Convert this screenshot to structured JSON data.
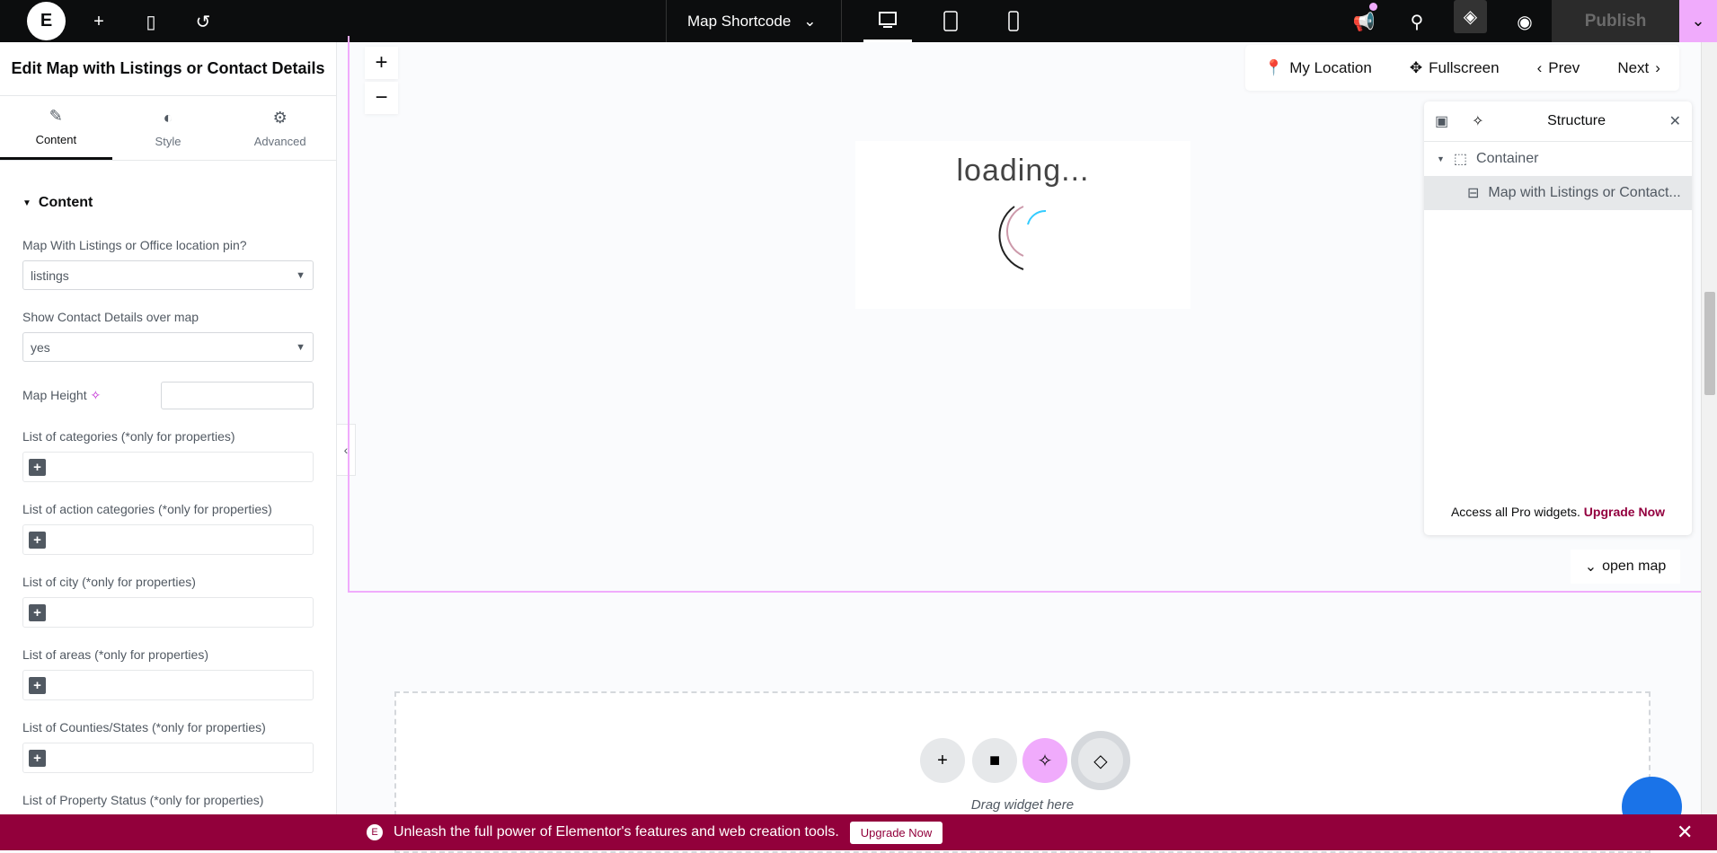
{
  "topbar": {
    "doc_title": "Map Shortcode",
    "publish": "Publish"
  },
  "panel": {
    "title": "Edit Map with Listings or Contact Details",
    "tabs": [
      {
        "label": "Content"
      },
      {
        "label": "Style"
      },
      {
        "label": "Advanced"
      }
    ],
    "section": "Content",
    "fields": {
      "map_type_label": "Map With Listings or Office location pin?",
      "map_type_value": "listings",
      "contact_label": "Show Contact Details over map",
      "contact_value": "yes",
      "height_label": "Map Height"
    },
    "repeaters": [
      {
        "label": "List of categories (*only for properties)"
      },
      {
        "label": "List of action categories (*only for properties)"
      },
      {
        "label": "List of city (*only for properties)"
      },
      {
        "label": "List of areas (*only for properties)"
      },
      {
        "label": "List of Counties/States (*only for properties)"
      },
      {
        "label": "List of Property Status (*only for properties)"
      }
    ]
  },
  "map": {
    "loading": "loading...",
    "my_location": "My Location",
    "fullscreen": "Fullscreen",
    "prev": "Prev",
    "next": "Next",
    "open_map": "open map"
  },
  "structure": {
    "title": "Structure",
    "container": "Container",
    "widget": "Map with Listings or Contact...",
    "promo": "Access all Pro widgets.",
    "upgrade": "Upgrade Now"
  },
  "canvas": {
    "drag": "Drag widget here"
  },
  "promo": {
    "text": "Unleash the full power of Elementor's features and web creation tools.",
    "button": "Upgrade Now"
  },
  "colors": {
    "accent": "#92003b",
    "pink": "#f0abfc"
  }
}
